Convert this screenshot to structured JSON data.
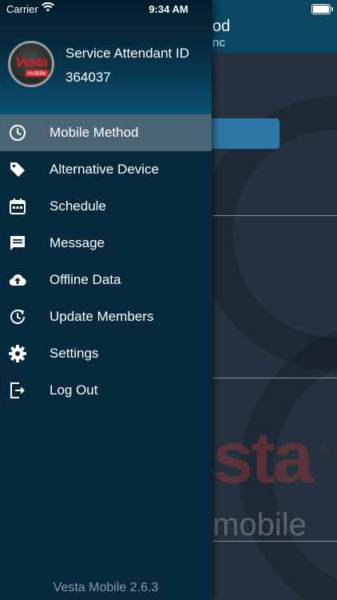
{
  "status_bar": {
    "carrier": "Carrier",
    "time": "9:34 AM"
  },
  "background": {
    "title_partial": "od",
    "subtitle_partial": "nc",
    "logo_text": "sta",
    "logo_sub": "mobile",
    "logo_mark": "®"
  },
  "drawer": {
    "avatar": {
      "brand": "Vesta",
      "tag": "mobile"
    },
    "attendant_label": "Service Attendant ID",
    "attendant_id": "364037",
    "menu": [
      {
        "label": "Mobile Method",
        "icon": "clock-icon",
        "active": true
      },
      {
        "label": "Alternative Device",
        "icon": "tag-icon",
        "active": false
      },
      {
        "label": "Schedule",
        "icon": "calendar-icon",
        "active": false
      },
      {
        "label": "Message",
        "icon": "message-icon",
        "active": false
      },
      {
        "label": "Offline Data",
        "icon": "cloud-upload-icon",
        "active": false
      },
      {
        "label": "Update Members",
        "icon": "refresh-clock-icon",
        "active": false
      },
      {
        "label": "Settings",
        "icon": "gear-icon",
        "active": false
      },
      {
        "label": "Log Out",
        "icon": "logout-icon",
        "active": false
      }
    ],
    "version": "Vesta Mobile 2.6.3"
  },
  "colors": {
    "drawer_bg": "#06293d",
    "active_item": "#4b6574",
    "header_bg": "#0b4663",
    "brand_red": "#d42127"
  }
}
